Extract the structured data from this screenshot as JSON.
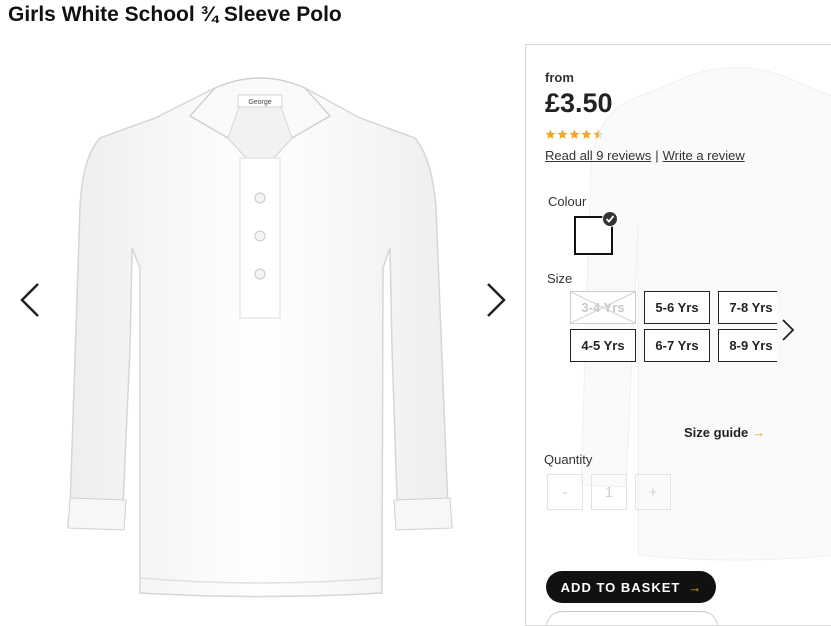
{
  "product": {
    "title": "Girls White School ¾ Sleeve Polo",
    "shirt_label": "George"
  },
  "panel": {
    "from_label": "from",
    "price": "£3.50",
    "rating": 4.5,
    "rating_max": 5,
    "star_color": "#f5a623",
    "read_reviews": "Read all 9 reviews",
    "separator": "|",
    "write_review": "Write a review",
    "colour_label": "Colour",
    "size_label": "Size",
    "sizes": [
      {
        "label": "3-4 Yrs",
        "available": false
      },
      {
        "label": "4-5 Yrs",
        "available": true
      },
      {
        "label": "5-6 Yrs",
        "available": true
      },
      {
        "label": "6-7 Yrs",
        "available": true
      },
      {
        "label": "7-8 Yrs",
        "available": true
      },
      {
        "label": "8-9 Yrs",
        "available": true
      }
    ],
    "size_guide": "Size guide",
    "size_guide_arrow": "→",
    "quantity_label": "Quantity",
    "quantity": {
      "minus": "-",
      "value": "1",
      "plus": "+"
    },
    "add_to_basket": "ADD TO BASKET",
    "basket_arrow": "→"
  },
  "icons": {
    "prev": "chevron-left-icon",
    "next": "chevron-right-icon",
    "sizes_next": "chevron-right-icon"
  }
}
